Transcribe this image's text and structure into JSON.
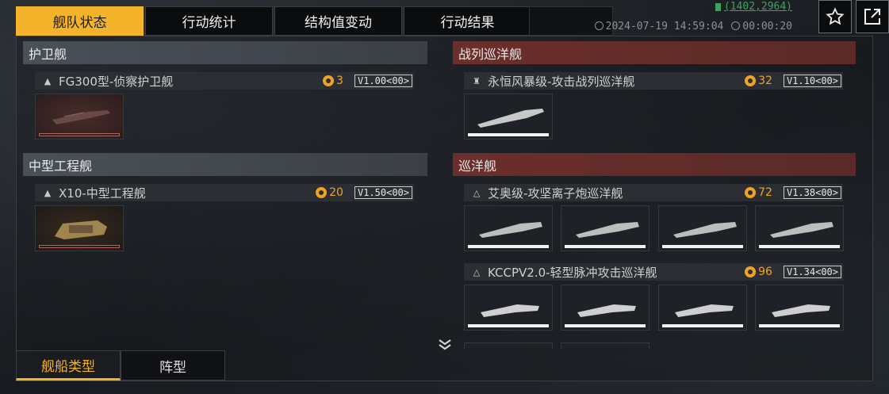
{
  "top_tabs": [
    {
      "label": "舰队状态",
      "active": true
    },
    {
      "label": "行动统计",
      "active": false
    },
    {
      "label": "结构值变动",
      "active": false
    },
    {
      "label": "行动结果",
      "active": false
    }
  ],
  "coordinates": "(1402,2964)",
  "timestamp": "2024-07-19 14:59:04",
  "duration": "00:00:20",
  "sections": {
    "frigate": {
      "title": "护卫舰",
      "ship": {
        "name": "FG300型-侦察护卫舰",
        "cost": "3",
        "version": "V1.00<00>"
      }
    },
    "engineering": {
      "title": "中型工程舰",
      "ship": {
        "name": "X10-中型工程舰",
        "cost": "20",
        "version": "V1.50<00>"
      }
    },
    "battlecruiser": {
      "title": "战列巡洋舰",
      "ship": {
        "name": "永恒风暴级-攻击战列巡洋舰",
        "cost": "32",
        "version": "V1.10<00>"
      }
    },
    "cruiser": {
      "title": "巡洋舰",
      "ships": [
        {
          "name": "艾奥级-攻坚离子炮巡洋舰",
          "cost": "72",
          "version": "V1.38<00>"
        },
        {
          "name": "KCCPV2.0-轻型脉冲攻击巡洋舰",
          "cost": "96",
          "version": "V1.34<00>"
        }
      ]
    }
  },
  "bottom_tabs": [
    {
      "label": "舰船类型",
      "active": true
    },
    {
      "label": "阵型",
      "active": false
    }
  ],
  "colors": {
    "accent": "#f3b32a",
    "cost": "#f0a323",
    "red_header": "#6b2e2b",
    "coord": "#3aa55c"
  },
  "icons": [
    "star-icon",
    "share-icon",
    "clock-icon",
    "timer-icon",
    "cost-icon",
    "chevron-down-icon",
    "rank-icon"
  ]
}
